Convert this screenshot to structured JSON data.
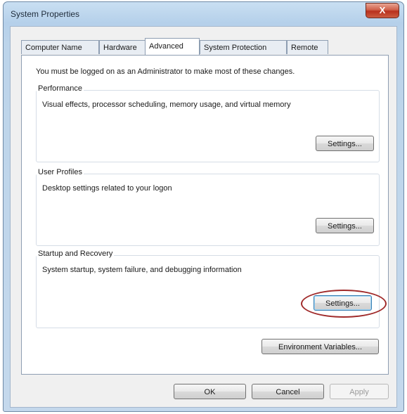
{
  "window": {
    "title": "System Properties",
    "close_label": "X"
  },
  "tabs": [
    {
      "label": "Computer Name"
    },
    {
      "label": "Hardware"
    },
    {
      "label": "Advanced"
    },
    {
      "label": "System Protection"
    },
    {
      "label": "Remote"
    }
  ],
  "active_tab": "Advanced",
  "intro_text": "You must be logged on as an Administrator to make most of these changes.",
  "groups": {
    "performance": {
      "title": "Performance",
      "description": "Visual effects, processor scheduling, memory usage, and virtual memory",
      "button": "Settings..."
    },
    "user_profiles": {
      "title": "User Profiles",
      "description": "Desktop settings related to your logon",
      "button": "Settings..."
    },
    "startup_recovery": {
      "title": "Startup and Recovery",
      "description": "System startup, system failure, and debugging information",
      "button": "Settings..."
    }
  },
  "env_button": "Environment Variables...",
  "footer": {
    "ok": "OK",
    "cancel": "Cancel",
    "apply": "Apply"
  },
  "colors": {
    "highlight_ring": "#a02a2a",
    "close_button": "#c8432c"
  }
}
